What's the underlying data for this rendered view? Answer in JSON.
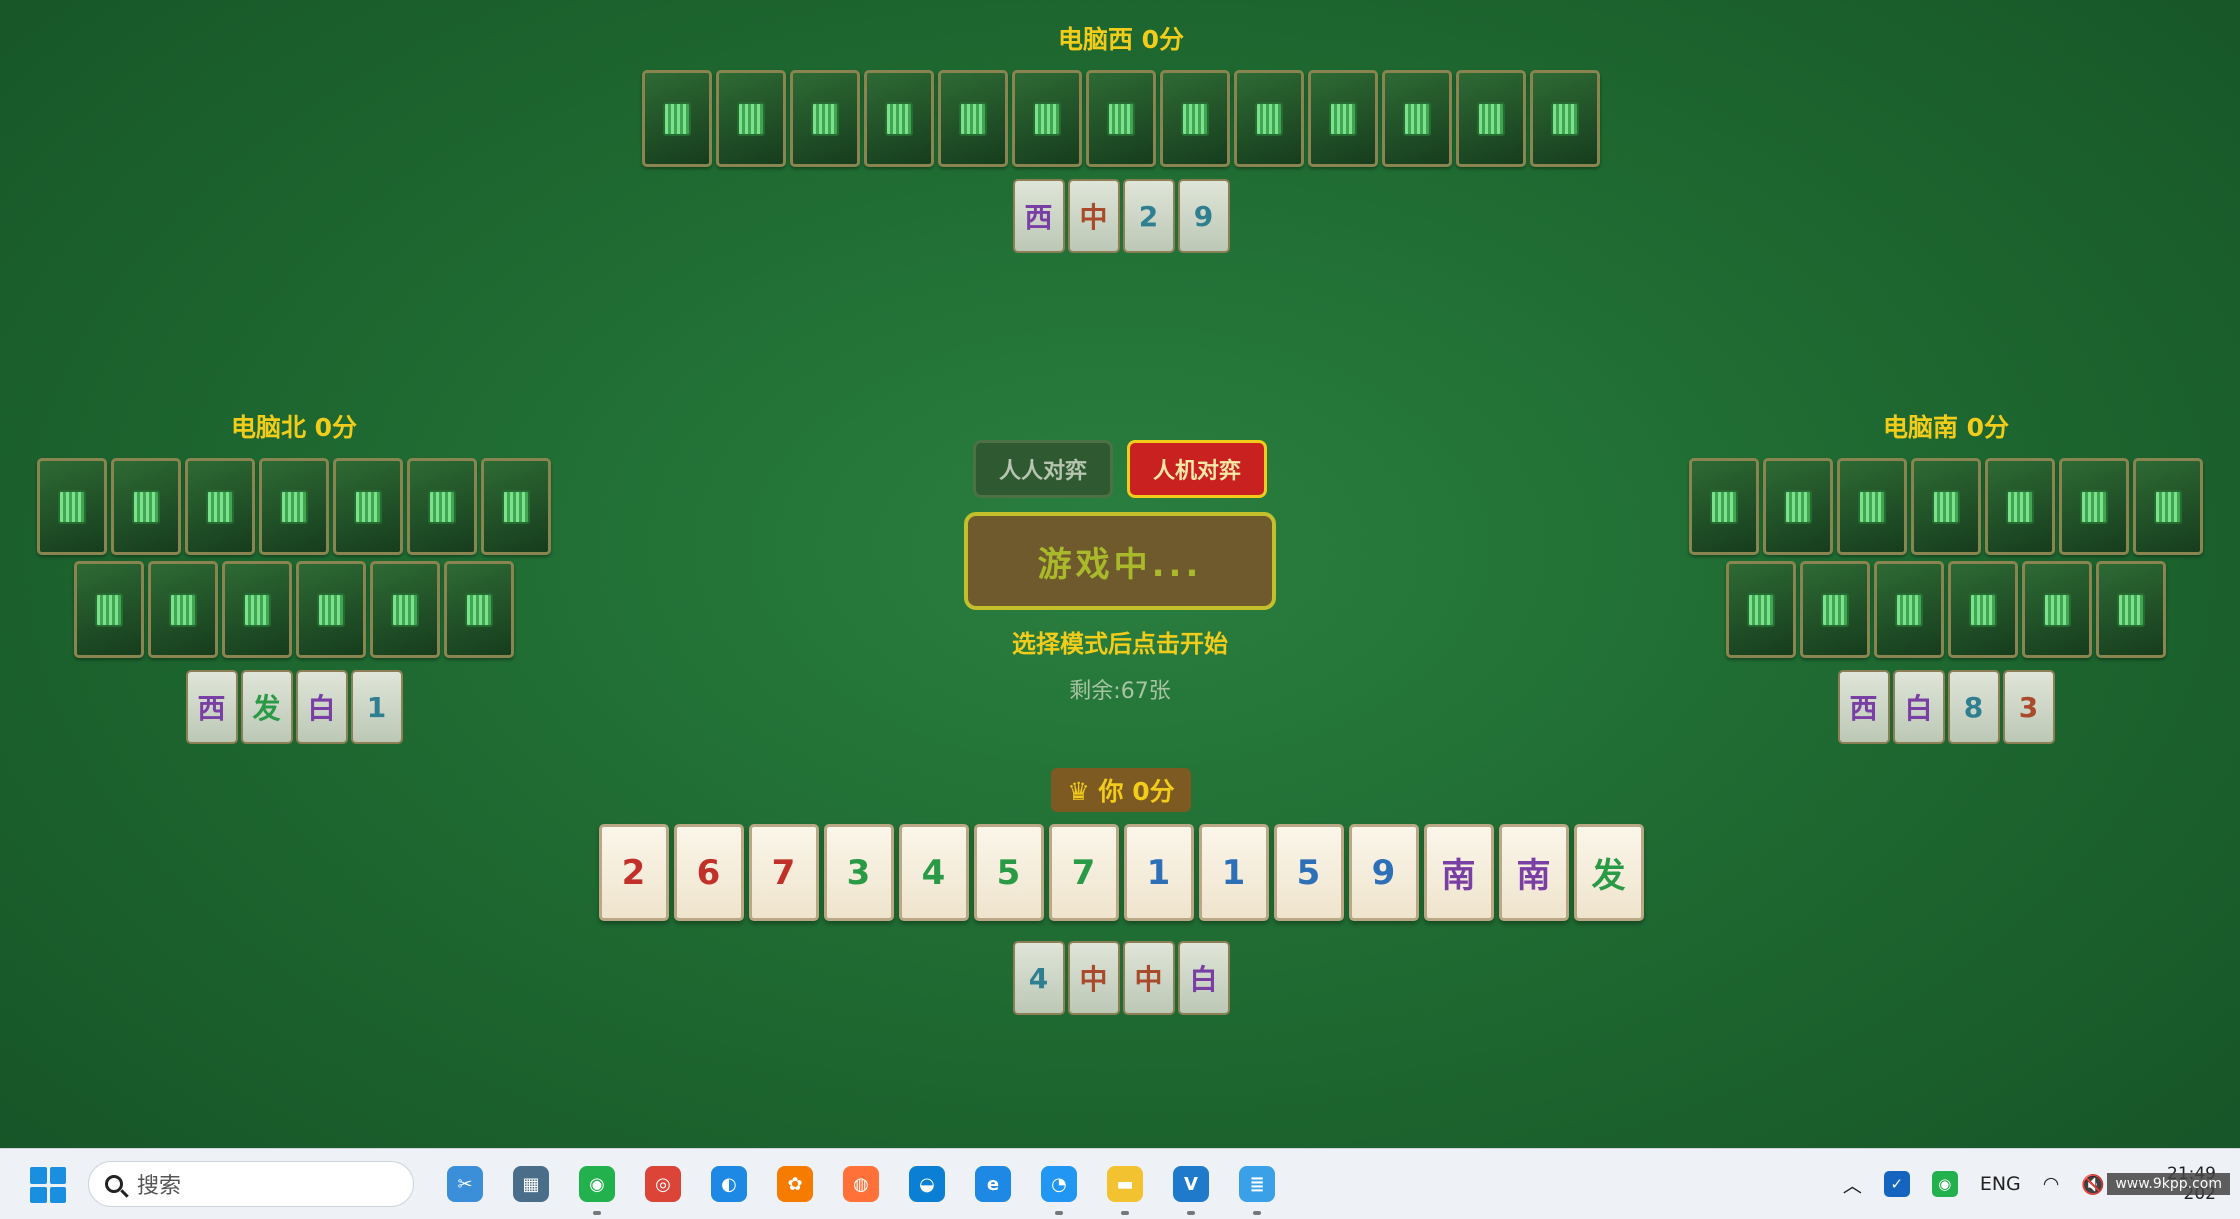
{
  "players": {
    "west": {
      "name": "电脑西 0分",
      "hidden_count": 13,
      "melds": [
        {
          "t": "西",
          "c": "purple"
        },
        {
          "t": "中",
          "c": "brown"
        },
        {
          "t": "2",
          "c": "teal"
        },
        {
          "t": "9",
          "c": "teal"
        }
      ]
    },
    "north": {
      "name": "电脑北 0分",
      "hidden_rows": [
        7,
        6
      ],
      "melds": [
        {
          "t": "西",
          "c": "purple"
        },
        {
          "t": "发",
          "c": "green"
        },
        {
          "t": "白",
          "c": "purple"
        },
        {
          "t": "1",
          "c": "teal"
        }
      ]
    },
    "south": {
      "name": "电脑南 0分",
      "hidden_rows": [
        7,
        6
      ],
      "melds": [
        {
          "t": "西",
          "c": "purple"
        },
        {
          "t": "白",
          "c": "purple"
        },
        {
          "t": "8",
          "c": "teal"
        },
        {
          "t": "3",
          "c": "brown"
        }
      ]
    },
    "you": {
      "name": "♛ 你 0分",
      "hand": [
        {
          "t": "2",
          "c": "red"
        },
        {
          "t": "6",
          "c": "red"
        },
        {
          "t": "7",
          "c": "red"
        },
        {
          "t": "3",
          "c": "green"
        },
        {
          "t": "4",
          "c": "green"
        },
        {
          "t": "5",
          "c": "green"
        },
        {
          "t": "7",
          "c": "green"
        },
        {
          "t": "1",
          "c": "blue"
        },
        {
          "t": "1",
          "c": "blue"
        },
        {
          "t": "5",
          "c": "blue"
        },
        {
          "t": "9",
          "c": "blue"
        },
        {
          "t": "南",
          "c": "purple"
        },
        {
          "t": "南",
          "c": "purple"
        },
        {
          "t": "发",
          "c": "green"
        }
      ],
      "melds": [
        {
          "t": "4",
          "c": "teal"
        },
        {
          "t": "中",
          "c": "brown"
        },
        {
          "t": "中",
          "c": "brown"
        },
        {
          "t": "白",
          "c": "purple"
        }
      ]
    }
  },
  "controls": {
    "mode_pvp": "人人对弈",
    "mode_pve": "人机对弈",
    "start_label": "游戏中...",
    "hint": "选择模式后点击开始",
    "remaining": "剩余:67张"
  },
  "taskbar": {
    "search_placeholder": "搜索",
    "apps": [
      {
        "name": "snipping-tool-icon",
        "color": "#3b8fd9",
        "glyph": "✂"
      },
      {
        "name": "calculator-icon",
        "color": "#4a6e8a",
        "glyph": "▦"
      },
      {
        "name": "wechat-icon",
        "color": "#22b14c",
        "glyph": "◉",
        "active": true
      },
      {
        "name": "chrome-icon",
        "color": "#db4437",
        "glyph": "◎"
      },
      {
        "name": "browser-icon",
        "color": "#1e88e5",
        "glyph": "◐"
      },
      {
        "name": "orange-app-icon",
        "color": "#f57c00",
        "glyph": "✿"
      },
      {
        "name": "firefox-icon",
        "color": "#ff7139",
        "glyph": "◍"
      },
      {
        "name": "edge-icon",
        "color": "#0b7fd4",
        "glyph": "◒"
      },
      {
        "name": "ie-icon",
        "color": "#1e88e5",
        "glyph": "e"
      },
      {
        "name": "qq-browser-icon",
        "color": "#2196f3",
        "glyph": "◔",
        "active": true
      },
      {
        "name": "file-explorer-icon",
        "color": "#f2c230",
        "glyph": "▬",
        "active": true
      },
      {
        "name": "vscode-icon",
        "color": "#1f7acc",
        "glyph": "V",
        "active": true
      },
      {
        "name": "notepad-icon",
        "color": "#3aa0e8",
        "glyph": "≣",
        "active": true
      }
    ],
    "tray_lang": "ENG",
    "time": "21:49",
    "date": "202",
    "watermark": "www.9kpp.com"
  }
}
